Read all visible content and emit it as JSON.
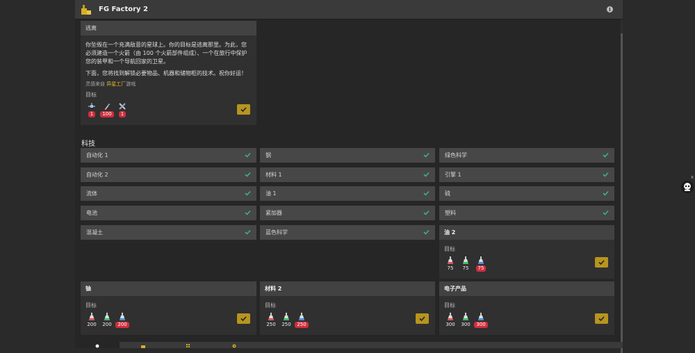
{
  "app": {
    "title": "FG Factory 2"
  },
  "escape": {
    "header": "逃离",
    "p1": "你坠毁在一个充满敌意的星球上。你的目标是逃离那里。为此，您必须建造一个火箭（由 100 个火箭部件组成）、一个在旅行中保护您的装甲和一个导航回家的卫星。",
    "p2": "下面，您将找到解锁必要物品、机器和储物柜的技术。祝你好运！",
    "credit_prefix": "灵感来自",
    "credit_link": "异星工厂",
    "credit_suffix": "游戏",
    "goal_label": "目标",
    "goals": [
      {
        "icon": "satellite-icon",
        "count": "1"
      },
      {
        "icon": "rocket-part-icon",
        "count": "100"
      },
      {
        "icon": "armor-icon",
        "count": "1"
      }
    ]
  },
  "tech_section": {
    "title": "科技"
  },
  "techs": [
    {
      "label": "自动化 1"
    },
    {
      "label": "钢"
    },
    {
      "label": "绿色科学"
    },
    {
      "label": "自动化 2"
    },
    {
      "label": "材料 1"
    },
    {
      "label": "引擎 1"
    },
    {
      "label": "流体"
    },
    {
      "label": "油 1"
    },
    {
      "label": "硫"
    },
    {
      "label": "电池"
    },
    {
      "label": "紧加器"
    },
    {
      "label": "塑料"
    },
    {
      "label": "混凝土"
    },
    {
      "label": "蓝色科学"
    }
  ],
  "research": [
    {
      "title": "油 2",
      "goal_label": "目标",
      "costs": [
        "75",
        "75",
        "75"
      ]
    },
    {
      "title": "铀",
      "goal_label": "目标",
      "costs": [
        "200",
        "200",
        "200"
      ]
    },
    {
      "title": "材料 2",
      "goal_label": "目标",
      "costs": [
        "250",
        "250",
        "250"
      ]
    },
    {
      "title": "电子产品",
      "goal_label": "目标",
      "costs": [
        "300",
        "300",
        "300"
      ]
    }
  ],
  "colors": {
    "accent": "#b8941f",
    "badge": "#d12e3d",
    "check": "#3fb27f",
    "flask_red": "#e05555",
    "flask_green": "#3fbf6a",
    "flask_blue": "#4a8fe0"
  },
  "float": {
    "close": "x"
  }
}
